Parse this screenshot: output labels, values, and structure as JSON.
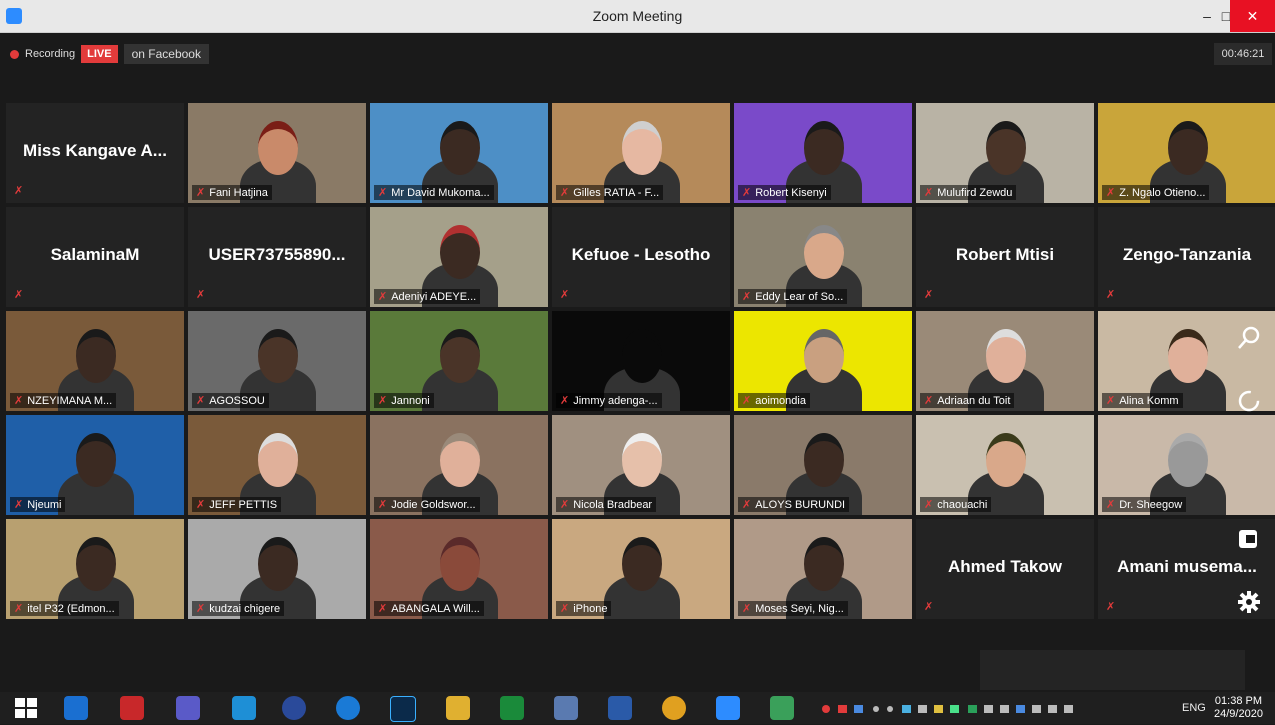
{
  "window": {
    "title": "Zoom Meeting",
    "min": "–",
    "max": "□",
    "close": "✕"
  },
  "header": {
    "recording": "Recording",
    "live": "LIVE",
    "platform": "on Facebook",
    "elapsed": "00:46:21"
  },
  "tiles": [
    {
      "name": "Miss Kangave A...",
      "video": false
    },
    {
      "name": "Fani Hatjina",
      "video": true,
      "bg": "#8a7a66",
      "skin": "#c98a6a",
      "hair": "#7a1e16"
    },
    {
      "name": "Mr David Mukoma...",
      "video": true,
      "bg": "#4d8fc6",
      "skin": "#3b2a22",
      "hair": "#1a1a1a"
    },
    {
      "name": "Gilles RATIA - F...",
      "video": true,
      "bg": "#b58a5a",
      "skin": "#e6b8a2",
      "hair": "#cfcfcf"
    },
    {
      "name": "Robert Kisenyi",
      "video": true,
      "bg": "#7a4ac9",
      "skin": "#3b2a22",
      "hair": "#1a1a1a"
    },
    {
      "name": "Mulufird Zewdu",
      "video": true,
      "bg": "#b9b3a5",
      "skin": "#4a3428",
      "hair": "#1a1a1a"
    },
    {
      "name": "Z. Ngalo Otieno...",
      "video": true,
      "bg": "#c9a53a",
      "skin": "#3b2a22",
      "hair": "#1a1a1a"
    },
    {
      "name": "SalaminaM",
      "video": false
    },
    {
      "name": "USER73755890...",
      "video": false
    },
    {
      "name": "Adeniyi ADEYE...",
      "video": true,
      "bg": "#a5a08a",
      "skin": "#3b2a22",
      "hair": "#b03030"
    },
    {
      "name": "Kefuoe - Lesotho",
      "video": false
    },
    {
      "name": "Eddy Lear of So...",
      "video": true,
      "bg": "#8a8270",
      "skin": "#d9a88a",
      "hair": "#888"
    },
    {
      "name": "Robert Mtisi",
      "video": false
    },
    {
      "name": "Zengo-Tanzania",
      "video": false
    },
    {
      "name": "NZEYIMANA M...",
      "video": true,
      "bg": "#7a5a3a",
      "skin": "#3b2a22",
      "hair": "#1a1a1a"
    },
    {
      "name": "AGOSSOU",
      "video": true,
      "bg": "#6a6a6a",
      "skin": "#4a3428",
      "hair": "#1a1a1a"
    },
    {
      "name": "Jannoni",
      "video": true,
      "bg": "#5a7a3a",
      "skin": "#4a3428",
      "hair": "#1a1a1a"
    },
    {
      "name": "Jimmy adenga-...",
      "video": true,
      "bg": "#0a0a0a",
      "skin": "#0a0a0a",
      "hair": "#0a0a0a"
    },
    {
      "name": "aoimondia",
      "video": true,
      "bg": "#ece600",
      "skin": "#c9a080",
      "hair": "#666"
    },
    {
      "name": "Adriaan du Toit",
      "video": true,
      "bg": "#9a8a78",
      "skin": "#e0b09a",
      "hair": "#ddd"
    },
    {
      "name": "Alina Komm",
      "video": true,
      "bg": "#c9b9a3",
      "skin": "#e0b09a",
      "hair": "#3a2a1a"
    },
    {
      "name": "Njeumi",
      "video": true,
      "bg": "#1f5fa8",
      "skin": "#3b2a22",
      "hair": "#1a1a1a"
    },
    {
      "name": "JEFF PETTIS",
      "video": true,
      "bg": "#7a5a3a",
      "skin": "#e0b09a",
      "hair": "#ddd"
    },
    {
      "name": "Jodie Goldswor...",
      "video": true,
      "bg": "#8a7260",
      "skin": "#e0b09a",
      "hair": "#9a8a7a"
    },
    {
      "name": "Nicola Bradbear",
      "video": true,
      "bg": "#a09080",
      "skin": "#e6c0aa",
      "hair": "#eee"
    },
    {
      "name": "ALOYS BURUNDI",
      "video": true,
      "bg": "#8a7a6a",
      "skin": "#3b2a22",
      "hair": "#1a1a1a"
    },
    {
      "name": "chaouachi",
      "video": true,
      "bg": "#c9c0b0",
      "skin": "#d9a88a",
      "hair": "#3a3a1a"
    },
    {
      "name": "Dr. Sheegow",
      "video": true,
      "bg": "#c9b9a9",
      "skin": "#999",
      "hair": "#aaa"
    },
    {
      "name": "itel P32 (Edmon...",
      "video": true,
      "bg": "#b8a070",
      "skin": "#3b2a22",
      "hair": "#1a1a1a"
    },
    {
      "name": "kudzai chigere",
      "video": true,
      "bg": "#aaa",
      "skin": "#3b2a22",
      "hair": "#1a1a1a"
    },
    {
      "name": "ABANGALA Will...",
      "video": true,
      "bg": "#8a5a4a",
      "skin": "#8a4a3a",
      "hair": "#5a2a2a"
    },
    {
      "name": "iPhone",
      "video": true,
      "bg": "#c9a880",
      "skin": "#3b2a22",
      "hair": "#1a1a1a"
    },
    {
      "name": "Moses Seyi, Nig...",
      "video": true,
      "bg": "#b09a88",
      "skin": "#3b2a22",
      "hair": "#1a1a1a"
    },
    {
      "name": "Ahmed Takow",
      "video": false
    },
    {
      "name": "Amani musema...",
      "video": false
    }
  ],
  "taskbar": {
    "lang": "ENG",
    "time": "01:38 PM",
    "date": "24/9/2020"
  },
  "icons": [
    "zoom-app-icon",
    "recording-dot-icon",
    "microphone-muted-icon",
    "search-icon",
    "refresh-icon",
    "leave-icon",
    "gear-icon",
    "windows-start-icon"
  ]
}
